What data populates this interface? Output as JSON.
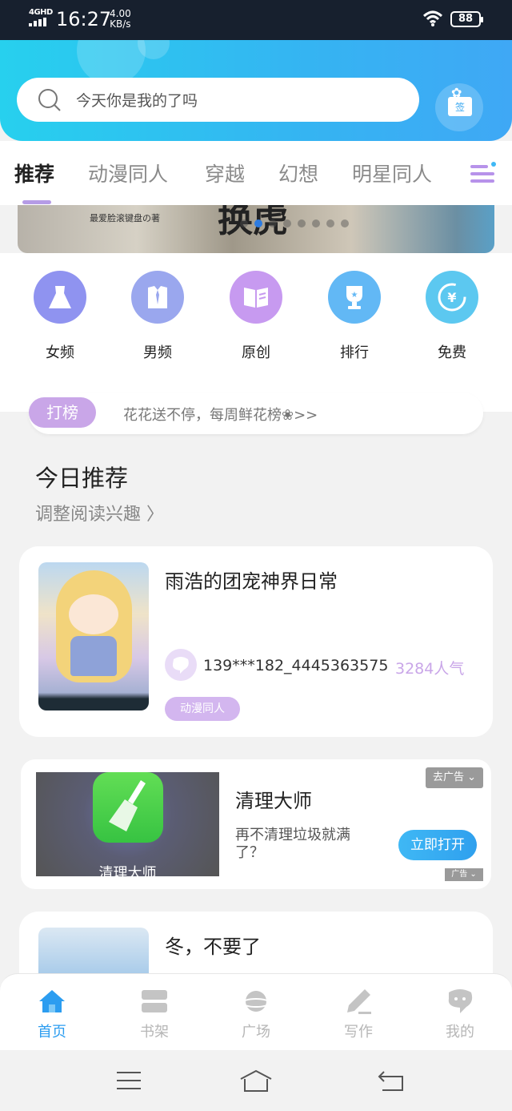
{
  "status_bar": {
    "network": "4GHD",
    "time": "16:27",
    "speed_value": "4.00",
    "speed_unit": "KB/s",
    "battery": "88"
  },
  "header": {
    "search_placeholder": "今天你是我的了吗",
    "signin_label": "签"
  },
  "tabs": [
    {
      "label": "推荐",
      "active": true
    },
    {
      "label": "动漫同人",
      "active": false
    },
    {
      "label": "穿越",
      "active": false
    },
    {
      "label": "幻想",
      "active": false
    },
    {
      "label": "明星同人",
      "active": false
    }
  ],
  "banner": {
    "caption": "最爱脸滚键盘の著",
    "title_fragment": "换虎",
    "active_dot": 1,
    "dot_count": 8
  },
  "categories": [
    {
      "label": "女频",
      "icon": "dress-icon",
      "color": "#8f93f0"
    },
    {
      "label": "男频",
      "icon": "shirt-icon",
      "color": "#9aa7ee"
    },
    {
      "label": "原创",
      "icon": "book-icon",
      "color": "#c79af0"
    },
    {
      "label": "排行",
      "icon": "trophy-icon",
      "color": "#62b8f5"
    },
    {
      "label": "免费",
      "icon": "yuan-icon",
      "color": "#5cc8f0"
    }
  ],
  "rank_banner": {
    "badge": "打榜",
    "text": "花花送不停，每周鲜花榜❀>>"
  },
  "section": {
    "title": "今日推荐",
    "subtitle": "调整阅读兴趣 〉"
  },
  "book": {
    "title": "雨浩的团宠神界日常",
    "author": "139***182_4445363575",
    "popularity": "3284人气",
    "tag": "动漫同人"
  },
  "ad": {
    "close_label": "去广告 ⌄",
    "image_text": "清理大师",
    "title": "清理大师",
    "description": "再不清理垃圾就满了？",
    "button": "立即打开",
    "ad_mark": "广告 ⌄"
  },
  "book2": {
    "title": "冬，不要了"
  },
  "bottom_nav": [
    {
      "label": "首页",
      "icon": "home-icon",
      "active": true
    },
    {
      "label": "书架",
      "icon": "bookshelf-icon",
      "active": false
    },
    {
      "label": "广场",
      "icon": "planet-icon",
      "active": false
    },
    {
      "label": "写作",
      "icon": "pen-icon",
      "active": false
    },
    {
      "label": "我的",
      "icon": "chat-bubble-icon",
      "active": false
    }
  ],
  "colors": {
    "accent": "#2c9df0",
    "purple": "#c9a6e8",
    "header_start": "#27d0ee",
    "header_end": "#3fa8f5"
  }
}
